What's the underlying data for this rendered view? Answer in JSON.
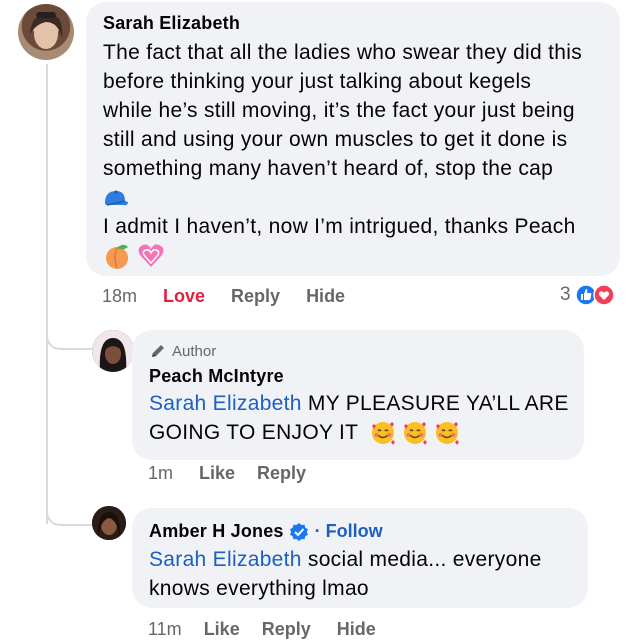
{
  "comments": [
    {
      "author": "Sarah Elizabeth",
      "lines": [
        "The fact that all the ladies who swear they did this",
        "before thinking your just talking about kegels",
        "while he’s still moving, it’s the fact your just being",
        "still and using your own muscles to get it done is",
        "something many haven’t heard of, stop the cap"
      ],
      "line2": "I admit I haven’t, now I’m intrigued, thanks Peach",
      "time": "18m",
      "love": "Love",
      "reply": "Reply",
      "hide": "Hide",
      "reaction_count": "3",
      "reaction_icons": [
        "like-icon",
        "heart-icon"
      ],
      "emojis": [
        "blue-cap-emoji",
        "peach-emoji",
        "growing-heart-emoji"
      ]
    },
    {
      "badge": "Author",
      "author": "Peach McIntyre",
      "mention": "Sarah Elizabeth",
      "line1_rest": " MY PLEASURE YA’LL ARE",
      "line2": "GOING TO ENJOY IT",
      "emojis": [
        "smiling-face-with-hearts-emoji",
        "smiling-face-with-hearts-emoji",
        "smiling-face-with-hearts-emoji"
      ],
      "time": "1m",
      "like": "Like",
      "reply": "Reply"
    },
    {
      "author": "Amber H Jones",
      "verified_icon": "verified-badge-icon",
      "follow": "· Follow",
      "mention": "Sarah Elizabeth",
      "line1_rest": " social media... everyone",
      "line2": "knows everything lmao",
      "time": "11m",
      "like": "Like",
      "reply": "Reply",
      "hide": "Hide"
    }
  ],
  "colors": {
    "bubble": "#f0f2f5",
    "mention": "#1b5fbf",
    "love": "#e41e3f",
    "meta": "#65676b",
    "like_blue": "#1877f2",
    "heart_red": "#f33e58"
  }
}
